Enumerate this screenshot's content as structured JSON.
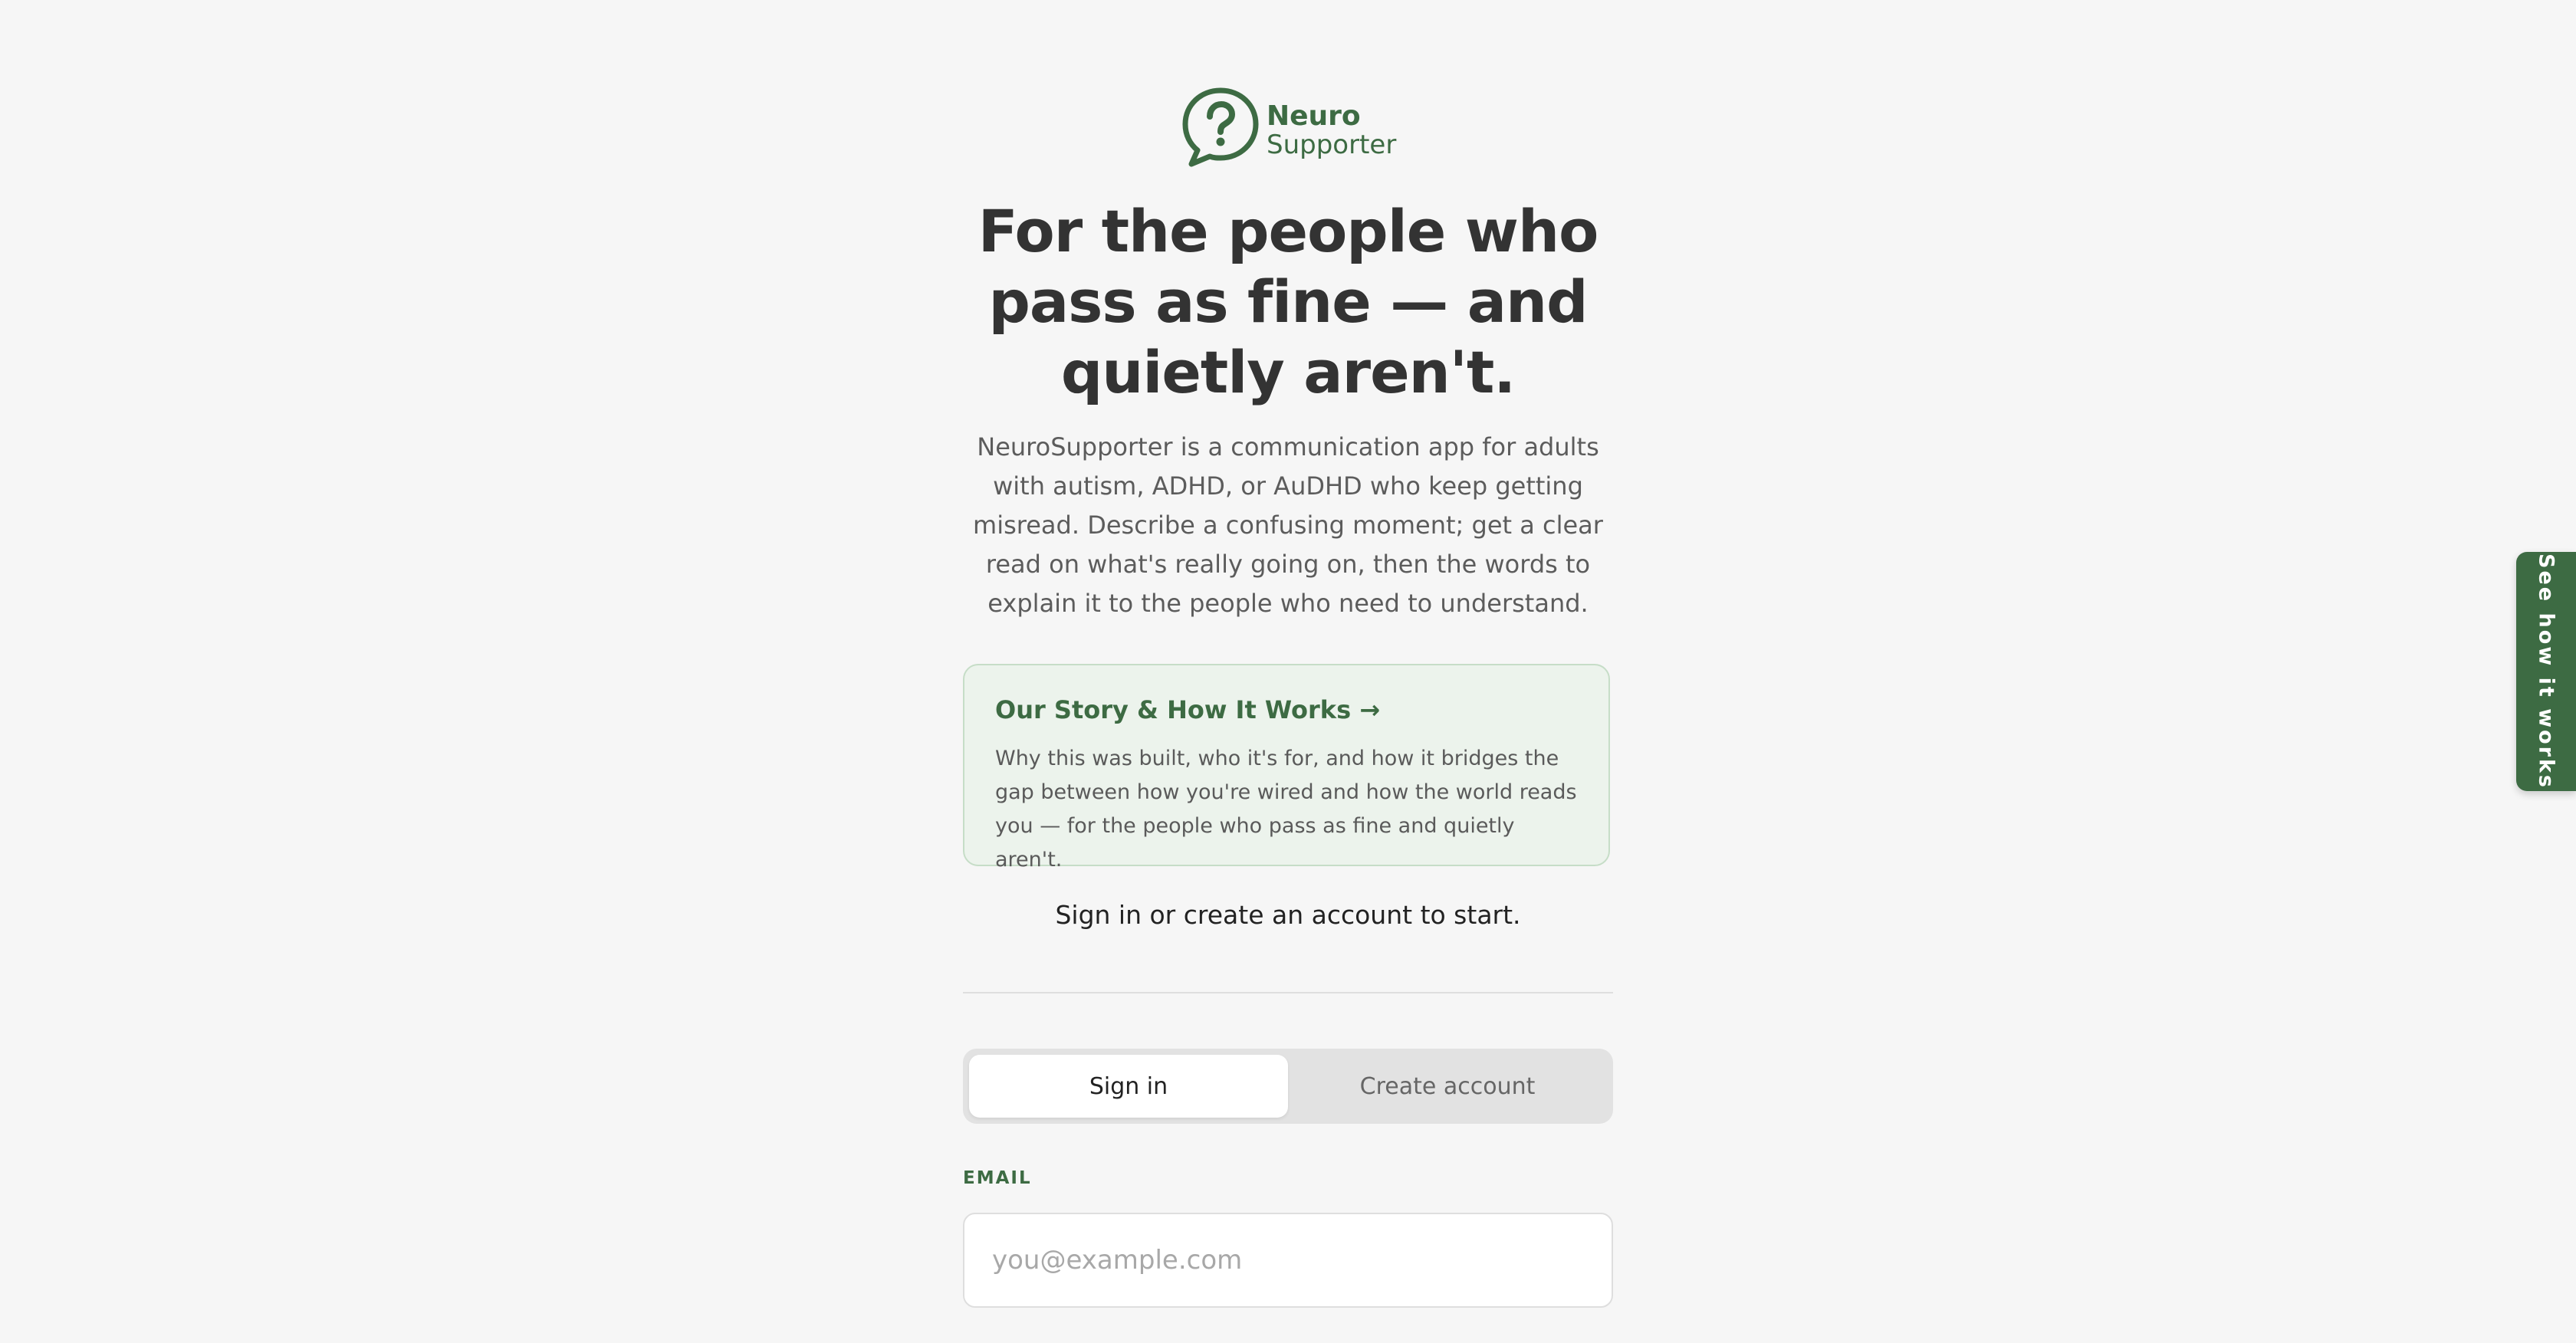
{
  "brand": {
    "name_line1": "Neuro",
    "name_line2": "Supporter",
    "logo_icon": "question-speech-bubble-icon",
    "accent_color": "#3d6b43"
  },
  "hero": {
    "headline": "For the people who pass as fine — and quietly aren't.",
    "description": "NeuroSupporter is a communication app for adults with autism, ADHD, or AuDHD who keep getting misread. Describe a confusing moment; get a clear read on what's really going on, then the words to explain it to the people who need to understand."
  },
  "story_card": {
    "title": "Our Story & How It Works →",
    "description": "Why this was built, who it's for, and how it bridges the gap between how you're wired and how the world reads you — for the people who pass as fine and quietly aren't."
  },
  "auth": {
    "prompt": "Sign in or create an account to start.",
    "tabs": [
      {
        "label": "Sign in",
        "active": true
      },
      {
        "label": "Create account",
        "active": false
      }
    ],
    "email_label": "EMAIL",
    "email_placeholder": "you@example.com",
    "email_value": ""
  },
  "side_tab": {
    "label": "See how it works"
  }
}
